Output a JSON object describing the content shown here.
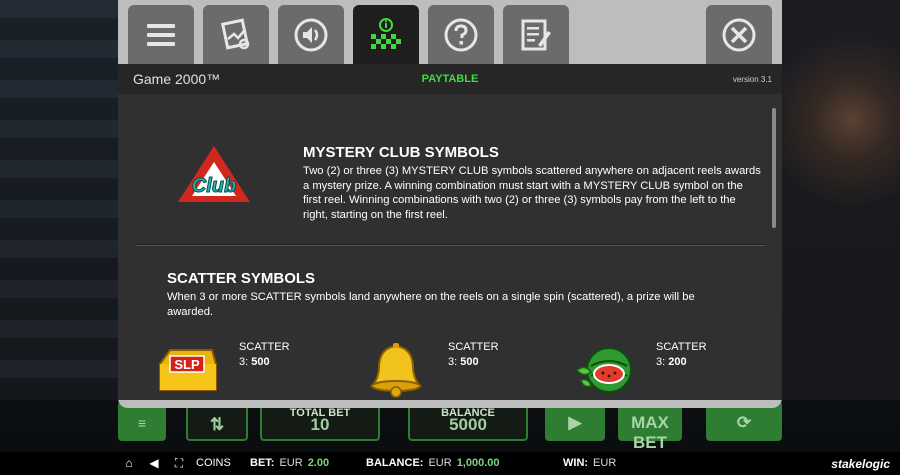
{
  "header": {
    "game_title": "Game 2000™",
    "section_title": "PAYTABLE",
    "version": "version 3.1"
  },
  "tabs": [
    {
      "icon": "menu-icon",
      "active": false
    },
    {
      "icon": "bet-settings-icon",
      "active": false
    },
    {
      "icon": "sound-icon",
      "active": false
    },
    {
      "icon": "paytable-icon",
      "active": true
    },
    {
      "icon": "help-icon",
      "active": false
    },
    {
      "icon": "rules-document-icon",
      "active": false
    },
    {
      "icon": "close-icon",
      "active": false
    }
  ],
  "mystery_club": {
    "title": "MYSTERY CLUB SYMBOLS",
    "text": "Two (2) or three (3) MYSTERY CLUB symbols scattered anywhere on adjacent reels awards a mystery prize. A winning combination must start with a MYSTERY CLUB symbol on the first reel. Winning combinations with two (2) or three (3) symbols pay from the left to the right, starting on the first reel.",
    "icon_label": "Club"
  },
  "scatter": {
    "title": "SCATTER SYMBOLS",
    "text": "When 3 or more SCATTER symbols land anywhere on the reels on a single spin (scattered), a prize will be awarded.",
    "symbols": [
      {
        "icon": "slp-bar-icon",
        "name": "SCATTER",
        "pay_prefix": "3:",
        "pay_value": "500",
        "badge": "SLP"
      },
      {
        "icon": "bell-icon",
        "name": "SCATTER",
        "pay_prefix": "3:",
        "pay_value": "500"
      },
      {
        "icon": "watermelon-icon",
        "name": "SCATTER",
        "pay_prefix": "3:",
        "pay_value": "200"
      }
    ]
  },
  "under_controls": {
    "total_bet_label": "TOTAL BET",
    "total_bet_value": "10",
    "balance_label": "BALANCE",
    "balance_value": "5000",
    "max_bet_label": "MAX BET"
  },
  "bottom_bar": {
    "coins_label": "COINS",
    "bet_label": "BET:",
    "bet_currency": "EUR",
    "bet_value": "2.00",
    "balance_label": "BALANCE:",
    "balance_currency": "EUR",
    "balance_value": "1,000.00",
    "win_label": "WIN:",
    "win_currency": "EUR",
    "brand": "stakelogic"
  },
  "colors": {
    "accent_green": "#3ddc3d",
    "panel_bg": "#303030",
    "tab_grey": "#6b6b6b"
  }
}
